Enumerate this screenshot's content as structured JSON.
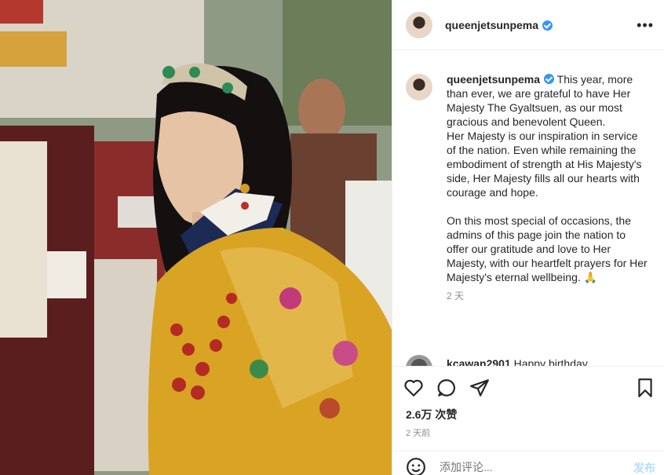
{
  "header": {
    "username": "queenjetsunpema",
    "more_label": "•••"
  },
  "caption": {
    "username": "queenjetsunpema",
    "text": "This year, more than ever, we are grateful to have Her Majesty The Gyaltsuen, as our most gracious and benevolent Queen.\nHer Majesty is our inspiration in service of the nation. Even while remaining the embodiment of strength at His Majesty's side, Her Majesty fills all our hearts with courage and hope.\n\nOn this most special of occasions, the admins of this page join the nation to offer our gratitude and love to Her Majesty, with our heartfelt prayers for Her Majesty's eternal wellbeing. 🙏",
    "time": "2 天"
  },
  "comment": {
    "username": "kcawan2901",
    "text": "Happy birthday"
  },
  "actions": {
    "likes": "2.6万 次赞",
    "post_time": "2 天前",
    "icons": [
      "heart-icon",
      "comment-icon",
      "share-icon",
      "bookmark-icon"
    ]
  },
  "comment_box": {
    "placeholder": "添加评论...",
    "post_label": "发布"
  },
  "colors": {
    "verified": "#3897f0",
    "post_button": "#b2dffc",
    "muted_text": "#8e8e8e"
  }
}
